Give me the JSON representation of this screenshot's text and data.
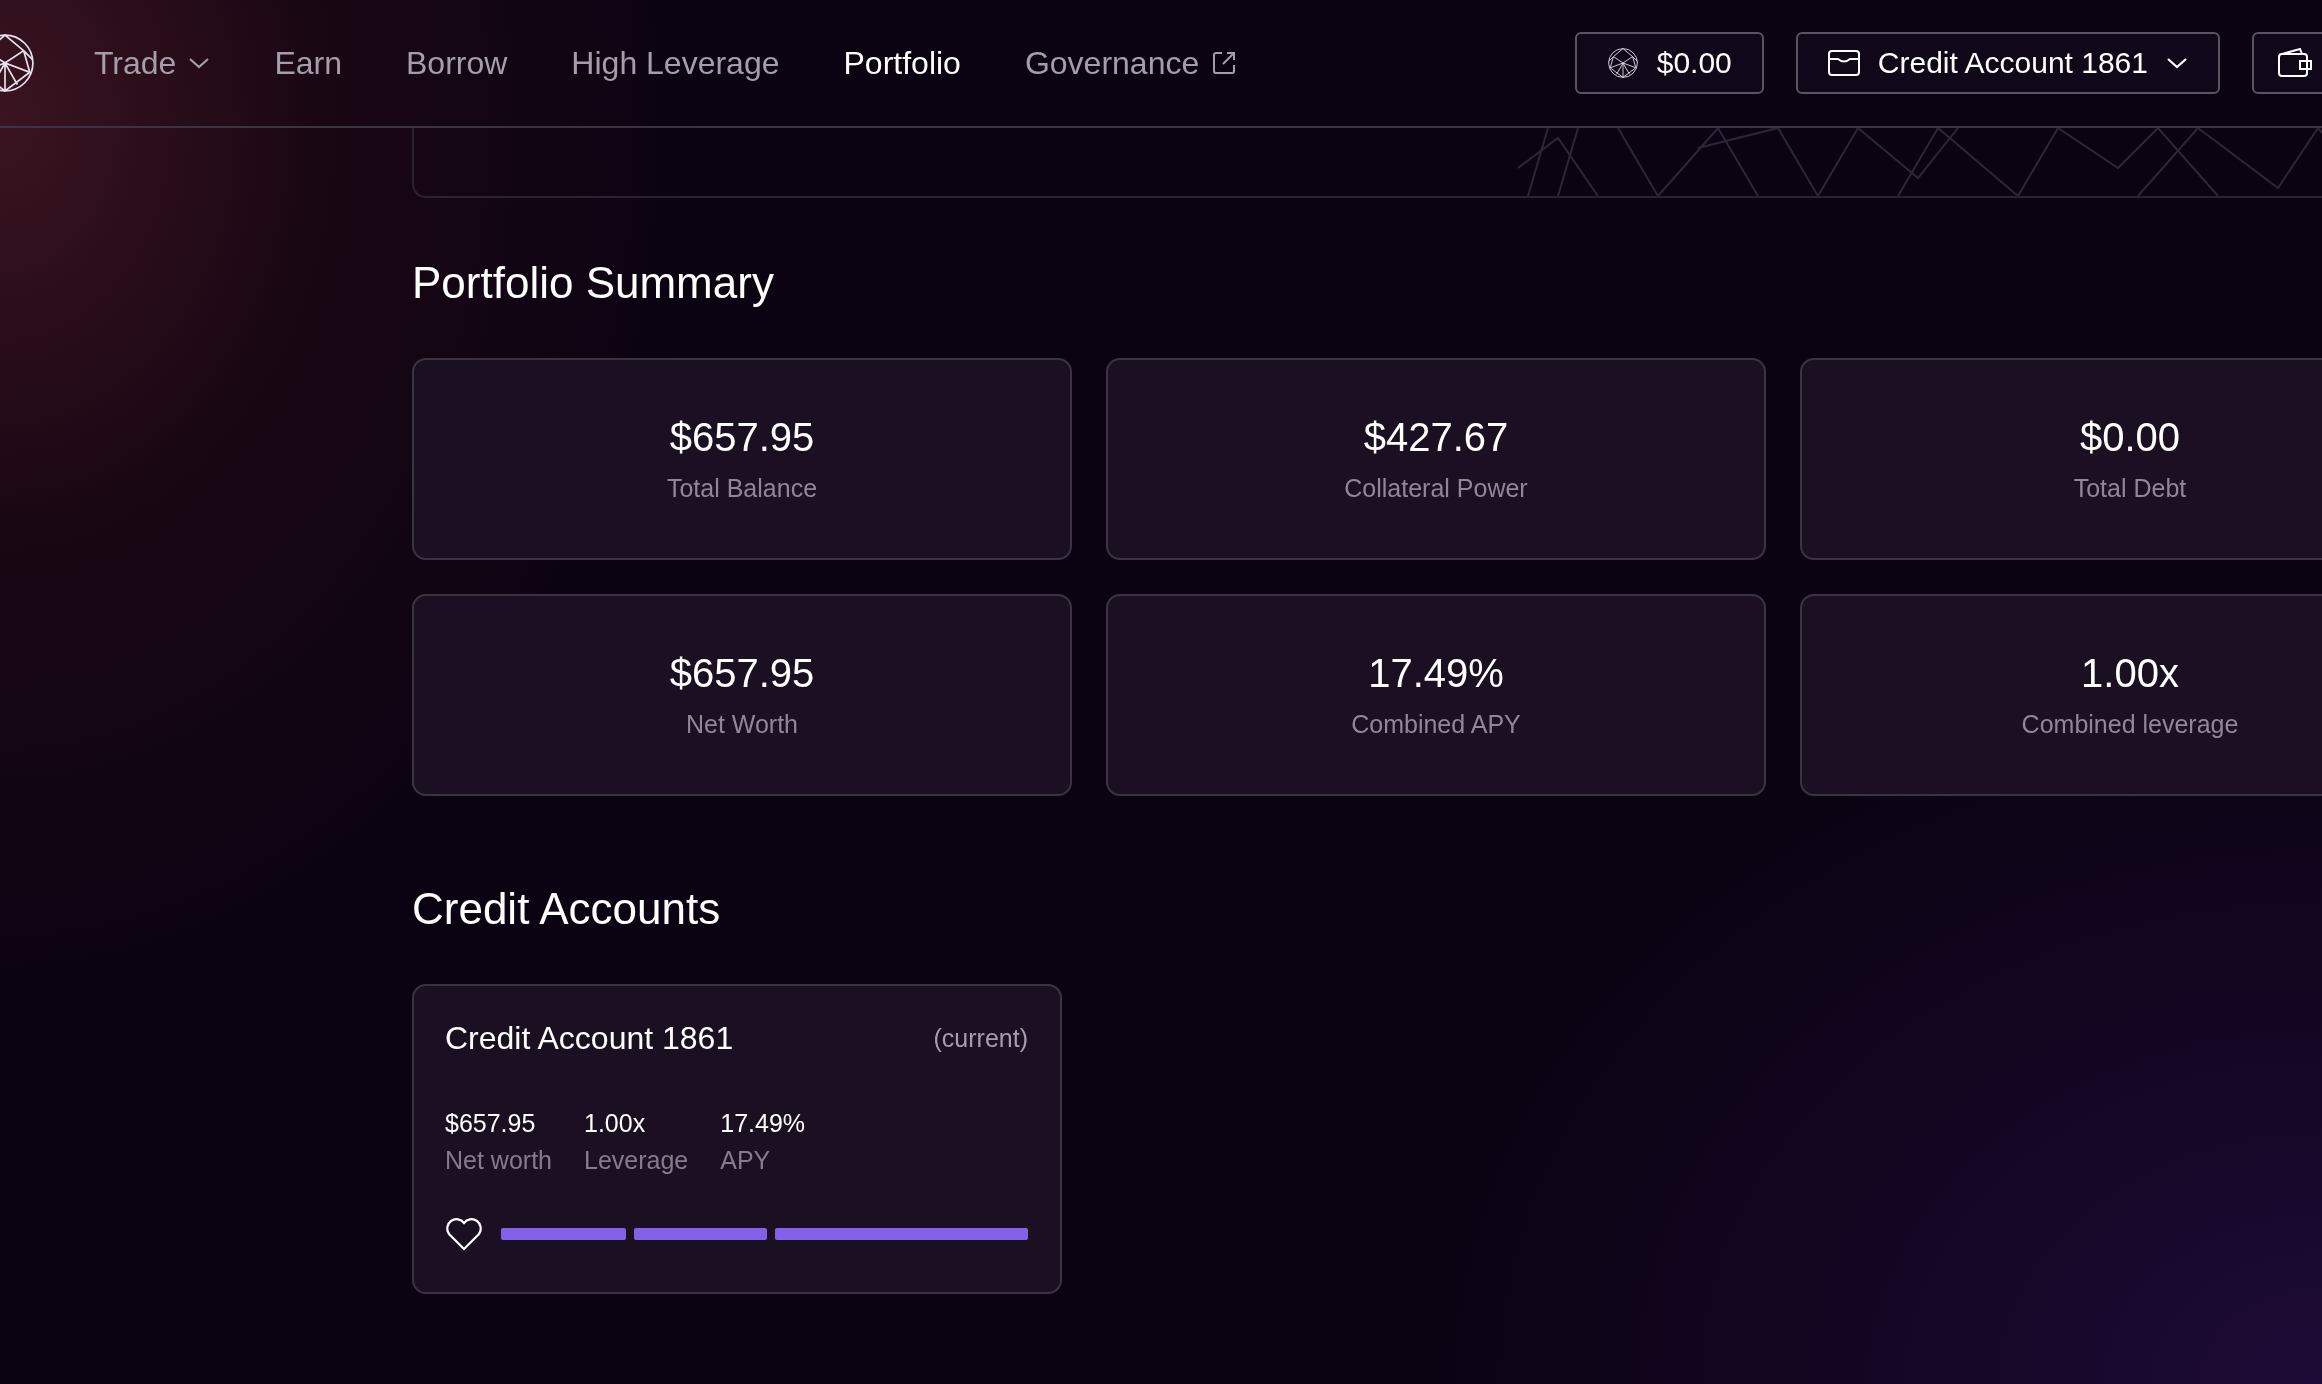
{
  "nav": {
    "items": [
      {
        "label": "Trade",
        "kind": "dropdown",
        "selected": false
      },
      {
        "label": "Earn",
        "kind": "plain",
        "selected": false
      },
      {
        "label": "Borrow",
        "kind": "plain",
        "selected": false
      },
      {
        "label": "High Leverage",
        "kind": "plain",
        "selected": false
      },
      {
        "label": "Portfolio",
        "kind": "plain",
        "selected": true
      },
      {
        "label": "Governance",
        "kind": "external",
        "selected": false
      }
    ],
    "balance": "$0.00",
    "account": "Credit Account 1861"
  },
  "summary": {
    "title": "Portfolio Summary",
    "stats": [
      {
        "value": "$657.95",
        "label": "Total Balance"
      },
      {
        "value": "$427.67",
        "label": "Collateral Power"
      },
      {
        "value": "$0.00",
        "label": "Total Debt"
      },
      {
        "value": "$657.95",
        "label": "Net Worth"
      },
      {
        "value": "17.49%",
        "label": "Combined APY"
      },
      {
        "value": "1.00x",
        "label": "Combined leverage"
      }
    ]
  },
  "credit_accounts": {
    "title": "Credit Accounts",
    "accounts": [
      {
        "name": "Credit Account 1861",
        "tag": "(current)",
        "stats": [
          {
            "value": "$657.95",
            "label": "Net worth"
          },
          {
            "value": "1.00x",
            "label": "Leverage"
          },
          {
            "value": "17.49%",
            "label": "APY"
          }
        ],
        "health": {
          "level": 1
        }
      }
    ]
  }
}
